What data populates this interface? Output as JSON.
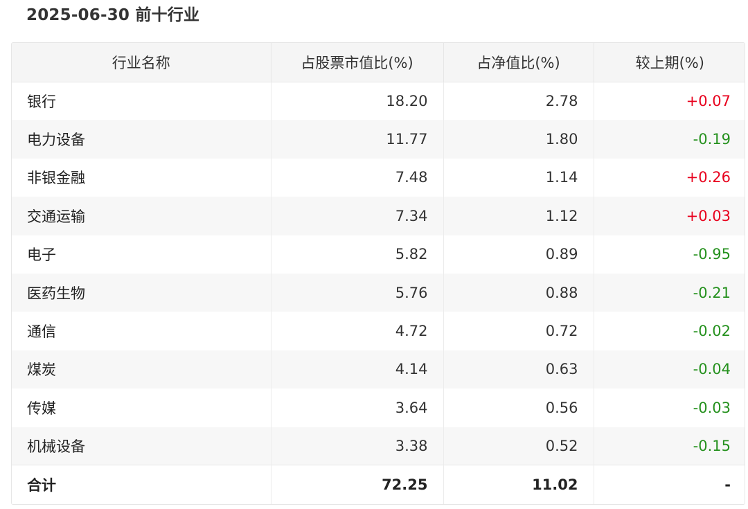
{
  "title": "2025-06-30 前十行业",
  "table": {
    "headers": [
      "行业名称",
      "占股票市值比(%)",
      "占净值比(%)",
      "较上期(%)"
    ],
    "rows": [
      {
        "name": "银行",
        "stock_ratio": "18.20",
        "nav_ratio": "2.78",
        "change": "+0.07",
        "trend": "up"
      },
      {
        "name": "电力设备",
        "stock_ratio": "11.77",
        "nav_ratio": "1.80",
        "change": "-0.19",
        "trend": "down"
      },
      {
        "name": "非银金融",
        "stock_ratio": "7.48",
        "nav_ratio": "1.14",
        "change": "+0.26",
        "trend": "up"
      },
      {
        "name": "交通运输",
        "stock_ratio": "7.34",
        "nav_ratio": "1.12",
        "change": "+0.03",
        "trend": "up"
      },
      {
        "name": "电子",
        "stock_ratio": "5.82",
        "nav_ratio": "0.89",
        "change": "-0.95",
        "trend": "down"
      },
      {
        "name": "医药生物",
        "stock_ratio": "5.76",
        "nav_ratio": "0.88",
        "change": "-0.21",
        "trend": "down"
      },
      {
        "name": "通信",
        "stock_ratio": "4.72",
        "nav_ratio": "0.72",
        "change": "-0.02",
        "trend": "down"
      },
      {
        "name": "煤炭",
        "stock_ratio": "4.14",
        "nav_ratio": "0.63",
        "change": "-0.04",
        "trend": "down"
      },
      {
        "name": "传媒",
        "stock_ratio": "3.64",
        "nav_ratio": "0.56",
        "change": "-0.03",
        "trend": "down"
      },
      {
        "name": "机械设备",
        "stock_ratio": "3.38",
        "nav_ratio": "0.52",
        "change": "-0.15",
        "trend": "down"
      }
    ],
    "total": {
      "name": "合计",
      "stock_ratio": "72.25",
      "nav_ratio": "11.02",
      "change": "-"
    }
  },
  "colors": {
    "up": "#e8001d",
    "down": "#25911e",
    "header_bg": "#f5f5f5",
    "stripe_bg": "#f7f7f7"
  }
}
